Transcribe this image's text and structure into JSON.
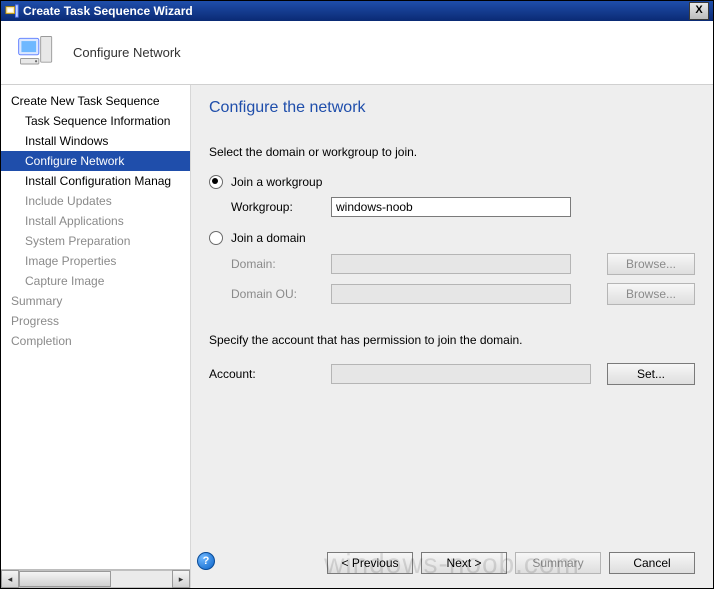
{
  "titlebar": {
    "title": "Create Task Sequence Wizard",
    "close": "X"
  },
  "header": {
    "text": "Configure Network"
  },
  "sidebar": {
    "items": [
      {
        "label": "Create New Task Sequence",
        "sub": false,
        "sel": false,
        "dim": false
      },
      {
        "label": "Task Sequence Information",
        "sub": true,
        "sel": false,
        "dim": false
      },
      {
        "label": "Install Windows",
        "sub": true,
        "sel": false,
        "dim": false
      },
      {
        "label": "Configure Network",
        "sub": true,
        "sel": true,
        "dim": false
      },
      {
        "label": "Install Configuration Manag",
        "sub": true,
        "sel": false,
        "dim": false
      },
      {
        "label": "Include Updates",
        "sub": true,
        "sel": false,
        "dim": true
      },
      {
        "label": "Install Applications",
        "sub": true,
        "sel": false,
        "dim": true
      },
      {
        "label": "System Preparation",
        "sub": true,
        "sel": false,
        "dim": true
      },
      {
        "label": "Image Properties",
        "sub": true,
        "sel": false,
        "dim": true
      },
      {
        "label": "Capture Image",
        "sub": true,
        "sel": false,
        "dim": true
      },
      {
        "label": "Summary",
        "sub": false,
        "sel": false,
        "dim": true
      },
      {
        "label": "Progress",
        "sub": false,
        "sel": false,
        "dim": true
      },
      {
        "label": "Completion",
        "sub": false,
        "sel": false,
        "dim": true
      }
    ]
  },
  "main": {
    "heading": "Configure the network",
    "instruction": "Select the domain or workgroup to join.",
    "join_workgroup_label": "Join a workgroup",
    "workgroup_label": "Workgroup:",
    "workgroup_value": "windows-noob",
    "join_domain_label": "Join a domain",
    "domain_label": "Domain:",
    "domain_value": "",
    "domain_ou_label": "Domain OU:",
    "domain_ou_value": "",
    "browse_label": "Browse...",
    "specify_text": "Specify the account that has permission to join the domain.",
    "account_label": "Account:",
    "account_value": "",
    "set_label": "Set...",
    "help": "?"
  },
  "buttons": {
    "previous": "< Previous",
    "next": "Next >",
    "summary": "Summary",
    "cancel": "Cancel"
  },
  "watermark": "windows-noob.com"
}
